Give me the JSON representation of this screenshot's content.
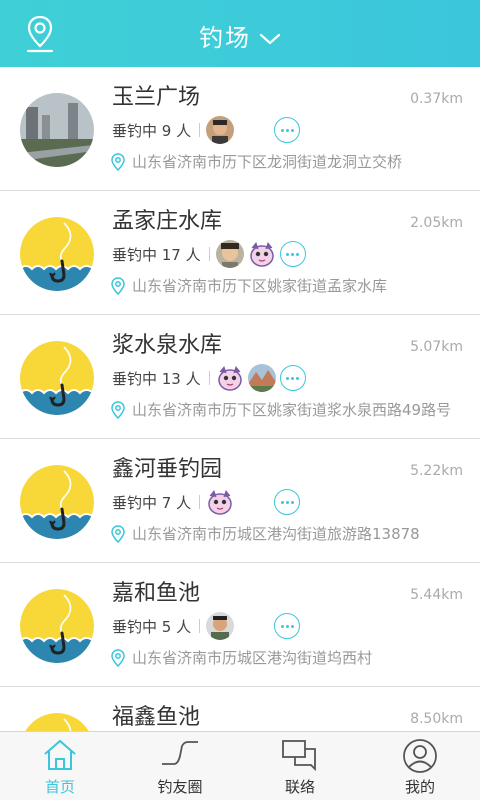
{
  "header": {
    "title": "钓场"
  },
  "spots": [
    {
      "name": "玉兰广场",
      "distance": "0.37km",
      "count": "垂钓中 9 人",
      "address": "山东省济南市历下区龙洞街道龙洞立交桥",
      "avatar": "photo",
      "faces": [
        "man1"
      ]
    },
    {
      "name": "孟家庄水库",
      "distance": "2.05km",
      "count": "垂钓中 17 人",
      "address": "山东省济南市历下区姚家街道孟家水库",
      "avatar": "hook",
      "faces": [
        "man2",
        "cartoon"
      ]
    },
    {
      "name": "浆水泉水库",
      "distance": "5.07km",
      "count": "垂钓中 13 人",
      "address": "山东省济南市历下区姚家街道浆水泉西路49路号",
      "avatar": "hook",
      "faces": [
        "cartoon",
        "scenery"
      ]
    },
    {
      "name": "鑫河垂钓园",
      "distance": "5.22km",
      "count": "垂钓中 7 人",
      "address": "山东省济南市历城区港沟街道旅游路13878",
      "avatar": "hook",
      "faces": [
        "cartoon"
      ]
    },
    {
      "name": "嘉和鱼池",
      "distance": "5.44km",
      "count": "垂钓中 5 人",
      "address": "山东省济南市历城区港沟街道坞西村",
      "avatar": "hook",
      "faces": [
        "man3"
      ]
    },
    {
      "name": "福鑫鱼池",
      "distance": "8.50km",
      "count": "",
      "address": "",
      "avatar": "hook",
      "faces": []
    }
  ],
  "tabs": [
    {
      "label": "首页",
      "icon": "home-icon",
      "active": true
    },
    {
      "label": "钓友圈",
      "icon": "circle-icon",
      "active": false
    },
    {
      "label": "联络",
      "icon": "chat-icon",
      "active": false
    },
    {
      "label": "我的",
      "icon": "user-icon",
      "active": false
    }
  ],
  "colors": {
    "accent": "#3cc6dc",
    "hook_bg": "#f7d838",
    "water": "#2d86b0"
  }
}
